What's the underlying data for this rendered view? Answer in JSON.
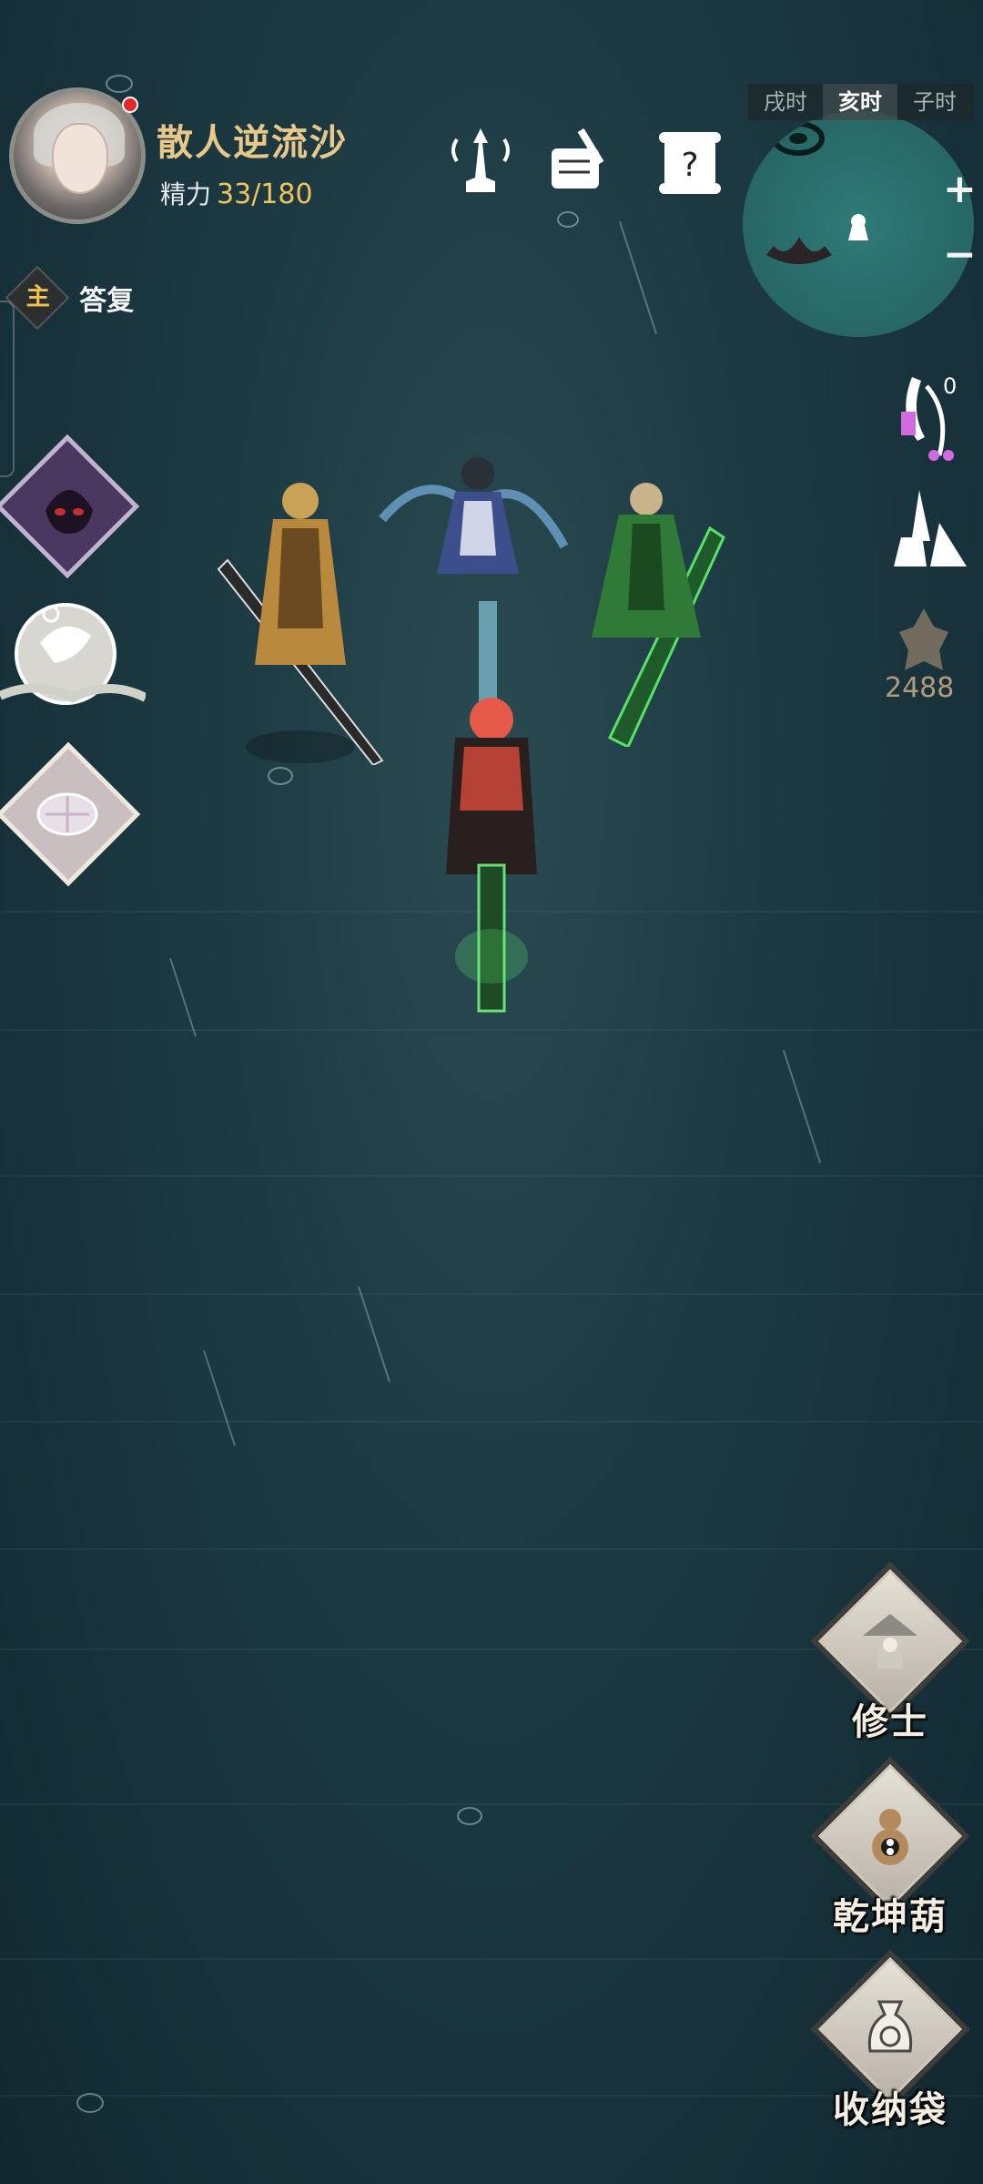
{
  "player": {
    "name": "散人逆流沙",
    "energy_label": "精力",
    "energy_value": "33/180"
  },
  "quest": {
    "badge": "主",
    "text": "答复"
  },
  "time_bar": [
    "戌时",
    "亥时",
    "子时"
  ],
  "time_active": "亥时",
  "minimap": {
    "zoom_in": "+",
    "zoom_out": "−"
  },
  "right_panel": {
    "notes_count": "0",
    "currency": "2488"
  },
  "actions": [
    {
      "label": "修士",
      "icon": "cultivator-icon"
    },
    {
      "label": "乾坤葫",
      "icon": "gourd-icon"
    },
    {
      "label": "收纳袋",
      "icon": "storage-bag-icon"
    }
  ],
  "colors": {
    "sea": "#1d3a42",
    "name_gold": "#e8c889",
    "energy_gold": "#f0c45a",
    "minimap_teal": "#2f7a78"
  }
}
